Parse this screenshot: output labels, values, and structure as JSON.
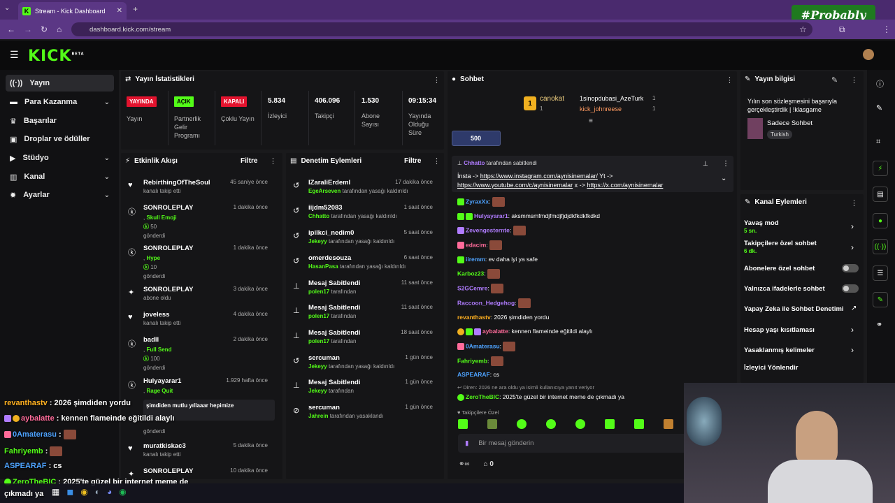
{
  "browser": {
    "tab_title": "Stream - Kick Dashboard",
    "url": "dashboard.kick.com/stream",
    "badge": "#Probably"
  },
  "header": {
    "logo": "KICK",
    "logo_sup": "BETA"
  },
  "sidebar": {
    "items": [
      {
        "label": "Yayın",
        "icon": "broadcast-icon"
      },
      {
        "label": "Para Kazanma",
        "icon": "money-icon"
      },
      {
        "label": "Başarılar",
        "icon": "trophy-icon"
      },
      {
        "label": "Droplar ve ödüller",
        "icon": "gift-icon"
      },
      {
        "label": "Stüdyo",
        "icon": "video-icon"
      },
      {
        "label": "Kanal",
        "icon": "chart-icon"
      },
      {
        "label": "Ayarlar",
        "icon": "gear-icon"
      }
    ]
  },
  "stats": {
    "title": "Yayın İstatistikleri",
    "items": [
      {
        "badge": "YAYINDA",
        "label": "Yayın",
        "color": "#e3132e"
      },
      {
        "badge": "AÇIK",
        "label": "Partnerlik Gelir Programı",
        "color": "#53fc18"
      },
      {
        "badge": "KAPALI",
        "label": "Çoklu Yayın",
        "color": "#e3132e"
      },
      {
        "value": "5.834",
        "label": "İzleyici"
      },
      {
        "value": "406.096",
        "label": "Takipçi"
      },
      {
        "value": "1.530",
        "label": "Abone Sayısı"
      },
      {
        "value": "09:15:34",
        "label": "Yayında Olduğu Süre"
      }
    ]
  },
  "activity": {
    "title": "Etkinlik Akışı",
    "filter": "Filtre",
    "rows": [
      {
        "name": "RebirthingOfTheSoul",
        "time": "45 saniye önce",
        "sub": "kanalı takip etti",
        "icon": "heart-icon"
      },
      {
        "name": "SONROLEPLAY",
        "time": "1 dakika önce",
        "g": "Skull Emoji",
        "amount": "50",
        "sub": "gönderdi",
        "icon": "kick-coin-icon"
      },
      {
        "name": "SONROLEPLAY",
        "time": "1 dakika önce",
        "g": "Hype",
        "amount": "10",
        "sub": "gönderdi",
        "icon": "kick-coin-icon"
      },
      {
        "name": "SONROLEPLAY",
        "time": "3 dakika önce",
        "sub": "abone oldu",
        "icon": "star-icon"
      },
      {
        "name": "joveless",
        "time": "4 dakika önce",
        "sub": "kanalı takip etti",
        "icon": "heart-icon"
      },
      {
        "name": "badll",
        "time": "2 dakika önce",
        "g": "Full Send",
        "amount": "100",
        "sub": "gönderdi",
        "icon": "kick-coin-icon"
      },
      {
        "name": "Hulyayarar1",
        "time": "1.929 hafta önce",
        "g": "Rage Quit",
        "msg": "şimdiden mutlu yıllaaar hepimize",
        "sub": "gönderdi",
        "icon": "kick-coin-icon"
      },
      {
        "name": "muratkiskac3",
        "time": "5 dakika önce",
        "sub": "kanalı takip etti",
        "icon": "heart-icon"
      },
      {
        "name": "SONROLEPLAY",
        "time": "10 dakika önce",
        "sub": "",
        "icon": "star-icon"
      }
    ]
  },
  "moderation": {
    "title": "Denetim Eylemleri",
    "filter": "Filtre",
    "rows": [
      {
        "name": "IZaraliErdemI",
        "time": "17 dakika önce",
        "by": "EgeArseven",
        "sub": "tarafından yasağı kaldırıldı",
        "icon": "undo-icon"
      },
      {
        "name": "iijdm52083",
        "time": "1 saat önce",
        "by": "Chhatto",
        "sub": "tarafından yasağı kaldırıldı",
        "icon": "undo-icon"
      },
      {
        "name": "ipilkci_nedim0",
        "time": "5 saat önce",
        "by": "Jekeyy",
        "sub": "tarafından yasağı kaldırıldı",
        "icon": "undo-icon"
      },
      {
        "name": "omerdesouza",
        "time": "6 saat önce",
        "by": "HasanPasa",
        "sub": "tarafından yasağı kaldırıldı",
        "icon": "undo-icon"
      },
      {
        "name": "Mesaj Sabitlendi",
        "time": "11 saat önce",
        "by": "polen17",
        "sub": "tarafından",
        "icon": "pin-icon"
      },
      {
        "name": "Mesaj Sabitlendi",
        "time": "11 saat önce",
        "by": "polen17",
        "sub": "tarafından",
        "icon": "pin-icon"
      },
      {
        "name": "Mesaj Sabitlendi",
        "time": "18 saat önce",
        "by": "polen17",
        "sub": "tarafından",
        "icon": "pin-icon"
      },
      {
        "name": "sercuman",
        "time": "1 gün önce",
        "by": "Jekeyy",
        "sub": "tarafından yasağı kaldırıldı",
        "icon": "undo-icon"
      },
      {
        "name": "Mesaj Sabitlendi",
        "time": "1 gün önce",
        "by": "Jekeyy",
        "sub": "tarafından",
        "icon": "pin-icon"
      },
      {
        "name": "sercuman",
        "time": "1 gün önce",
        "by": "Jahrein",
        "sub": "tarafından yasaklandı",
        "icon": "ban-icon"
      }
    ]
  },
  "chat": {
    "title": "Sohbet",
    "leaders": {
      "first": "canokat",
      "first_count": "1",
      "others": [
        {
          "name": "1sinopdubasi_AzeTurk",
          "count": "1"
        },
        {
          "name": "kick_johnreese",
          "count": "1"
        }
      ]
    },
    "pill": "500",
    "pinned": {
      "by": "Chhatto",
      "by_sub": "tarafından sabitlendi",
      "text_a": "İnsta -> ",
      "link1": "https://www.instagram.com/aynisinemalar/",
      "text_b": " Yt ->",
      "link2": "https://www.youtube.com/c/aynisinemalar",
      "text_c": " x -> ",
      "link3": "https://x.com/aynisinemalar"
    },
    "messages": [
      {
        "user": "ZyraxXx",
        "color": "#4ea3ff",
        "text": "",
        "emote": true
      },
      {
        "user": "Hulyayarar1",
        "color": "#b07cff",
        "text": ": aksmmsmfmdjfmdjfjdjdkfkdkfkdkd"
      },
      {
        "user": "Zevengesternte",
        "color": "#b07cff",
        "text": "",
        "emote": true
      },
      {
        "user": "edacim",
        "color": "#ff6b9a",
        "text": "",
        "emote": true
      },
      {
        "user": "iiremm",
        "color": "#4ea3ff",
        "text": ": ev daha iyi ya safe"
      },
      {
        "user": "Karboz23",
        "color": "#53fc18",
        "text": "",
        "emote": true
      },
      {
        "user": "S2GCemre",
        "color": "#b07cff",
        "text": "",
        "emote": true
      },
      {
        "user": "Raccoon_Hedgehog",
        "color": "#b07cff",
        "text": "",
        "emote": true
      },
      {
        "user": "revanthastv",
        "color": "#ffb020",
        "text": ": 2026 şimdiden yordu"
      },
      {
        "user": "aybalatte",
        "color": "#ff6b9a",
        "text": ": kennen flameinde eğitildi alaylı"
      },
      {
        "user": "0Amaterasu",
        "color": "#4ea3ff",
        "text": "",
        "emote": true
      },
      {
        "user": "Fahriyemb",
        "color": "#53fc18",
        "text": "",
        "emote": true
      },
      {
        "user": "ASPEARAF",
        "color": "#4ea3ff",
        "text": ": cs"
      }
    ],
    "reply_hint": "Diren: 2026 ne ara oldu ya isimli kullanıcıya yanıt veriyor",
    "reply": {
      "user": "ZeroTheBIC",
      "text": ": 2025'te güzel bir internet meme de çıkmadı ya"
    },
    "followers_only": "Takipçilere Özel",
    "input_placeholder": "Bir mesaj gönderin",
    "footer_count": "0"
  },
  "info": {
    "title": "Yayın bilgisi",
    "stream_title": "Yılın son sözleşmesini başarıyla gerçekleştirdik | !klasgame",
    "category": "Sadece Sohbet",
    "tag": "Turkish"
  },
  "channel_actions": {
    "title": "Kanal Eylemleri",
    "items": [
      {
        "label": "Yavaş mod",
        "sub": "5 sn.",
        "ctrl": "chevron"
      },
      {
        "label": "Takipçilere özel sohbet",
        "sub": "6 dk.",
        "ctrl": "chevron"
      },
      {
        "label": "Abonelere özel sohbet",
        "ctrl": "toggle"
      },
      {
        "label": "Yalnızca ifadelerle sohbet",
        "ctrl": "toggle"
      },
      {
        "label": "Yapay Zeka ile Sohbet Denetimi",
        "ctrl": "external"
      },
      {
        "label": "Hesap yaşı kısıtlaması",
        "ctrl": "chevron"
      },
      {
        "label": "Yasaklanmış kelimeler",
        "ctrl": "chevron"
      },
      {
        "label": "İzleyici Yönlendir",
        "ctrl": "none"
      }
    ]
  },
  "overlay": [
    {
      "user": "revanthastv",
      "color": "#ffb020",
      "text": " : 2026 şimdiden yordu"
    },
    {
      "user": "aybalatte",
      "color": "#ff6b9a",
      "text": " : kennen flameinde eğitildi alaylı"
    },
    {
      "user": "0Amaterasu",
      "color": "#4ea3ff",
      "text": " :"
    },
    {
      "user": "Fahriyemb",
      "color": "#53fc18",
      "text": " :"
    },
    {
      "user": "ASPEARAF",
      "color": "#4ea3ff",
      "text": " : cs"
    },
    {
      "user": "ZeroTheBIC",
      "color": "#53fc18",
      "text": " : 2025'te güzel bir internet meme de"
    },
    {
      "user": "",
      "color": "#fff",
      "text": "çıkmadı ya"
    }
  ]
}
